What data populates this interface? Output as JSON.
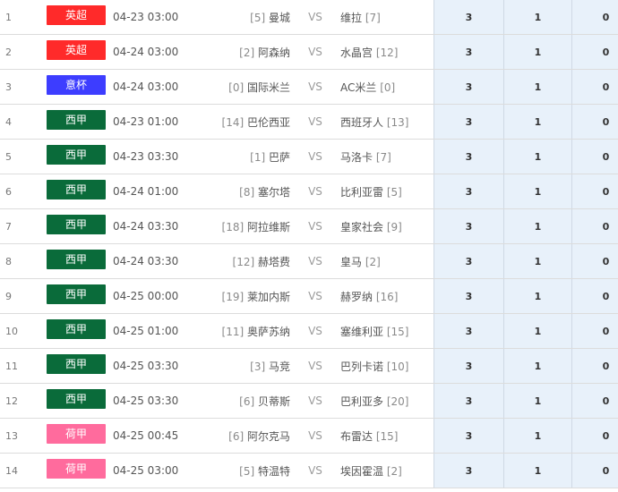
{
  "matches": [
    {
      "idx": "1",
      "league": "英超",
      "league_color": "#ff2a2a",
      "time": "04-23 03:00",
      "home_rank": "[5]",
      "home": "曼城",
      "vs": "VS",
      "away": "维拉",
      "away_rank": "[7]",
      "odds": [
        "3",
        "1",
        "0"
      ]
    },
    {
      "idx": "2",
      "league": "英超",
      "league_color": "#ff2a2a",
      "time": "04-24 03:00",
      "home_rank": "[2]",
      "home": "阿森纳",
      "vs": "VS",
      "away": "水晶宫",
      "away_rank": "[12]",
      "odds": [
        "3",
        "1",
        "0"
      ]
    },
    {
      "idx": "3",
      "league": "意杯",
      "league_color": "#3d3dff",
      "time": "04-24 03:00",
      "home_rank": "[0]",
      "home": "国际米兰",
      "vs": "VS",
      "away": "AC米兰",
      "away_rank": "[0]",
      "odds": [
        "3",
        "1",
        "0"
      ]
    },
    {
      "idx": "4",
      "league": "西甲",
      "league_color": "#0a6b3a",
      "time": "04-23 01:00",
      "home_rank": "[14]",
      "home": "巴伦西亚",
      "vs": "VS",
      "away": "西班牙人",
      "away_rank": "[13]",
      "odds": [
        "3",
        "1",
        "0"
      ]
    },
    {
      "idx": "5",
      "league": "西甲",
      "league_color": "#0a6b3a",
      "time": "04-23 03:30",
      "home_rank": "[1]",
      "home": "巴萨",
      "vs": "VS",
      "away": "马洛卡",
      "away_rank": "[7]",
      "odds": [
        "3",
        "1",
        "0"
      ]
    },
    {
      "idx": "6",
      "league": "西甲",
      "league_color": "#0a6b3a",
      "time": "04-24 01:00",
      "home_rank": "[8]",
      "home": "塞尔塔",
      "vs": "VS",
      "away": "比利亚雷",
      "away_rank": "[5]",
      "odds": [
        "3",
        "1",
        "0"
      ]
    },
    {
      "idx": "7",
      "league": "西甲",
      "league_color": "#0a6b3a",
      "time": "04-24 03:30",
      "home_rank": "[18]",
      "home": "阿拉维斯",
      "vs": "VS",
      "away": "皇家社会",
      "away_rank": "[9]",
      "odds": [
        "3",
        "1",
        "0"
      ]
    },
    {
      "idx": "8",
      "league": "西甲",
      "league_color": "#0a6b3a",
      "time": "04-24 03:30",
      "home_rank": "[12]",
      "home": "赫塔费",
      "vs": "VS",
      "away": "皇马",
      "away_rank": "[2]",
      "odds": [
        "3",
        "1",
        "0"
      ]
    },
    {
      "idx": "9",
      "league": "西甲",
      "league_color": "#0a6b3a",
      "time": "04-25 00:00",
      "home_rank": "[19]",
      "home": "莱加内斯",
      "vs": "VS",
      "away": "赫罗纳",
      "away_rank": "[16]",
      "odds": [
        "3",
        "1",
        "0"
      ]
    },
    {
      "idx": "10",
      "league": "西甲",
      "league_color": "#0a6b3a",
      "time": "04-25 01:00",
      "home_rank": "[11]",
      "home": "奥萨苏纳",
      "vs": "VS",
      "away": "塞维利亚",
      "away_rank": "[15]",
      "odds": [
        "3",
        "1",
        "0"
      ]
    },
    {
      "idx": "11",
      "league": "西甲",
      "league_color": "#0a6b3a",
      "time": "04-25 03:30",
      "home_rank": "[3]",
      "home": "马竞",
      "vs": "VS",
      "away": "巴列卡诺",
      "away_rank": "[10]",
      "odds": [
        "3",
        "1",
        "0"
      ]
    },
    {
      "idx": "12",
      "league": "西甲",
      "league_color": "#0a6b3a",
      "time": "04-25 03:30",
      "home_rank": "[6]",
      "home": "贝蒂斯",
      "vs": "VS",
      "away": "巴利亚多",
      "away_rank": "[20]",
      "odds": [
        "3",
        "1",
        "0"
      ]
    },
    {
      "idx": "13",
      "league": "荷甲",
      "league_color": "#ff6b9d",
      "time": "04-25 00:45",
      "home_rank": "[6]",
      "home": "阿尔克马",
      "vs": "VS",
      "away": "布雷达",
      "away_rank": "[15]",
      "odds": [
        "3",
        "1",
        "0"
      ]
    },
    {
      "idx": "14",
      "league": "荷甲",
      "league_color": "#ff6b9d",
      "time": "04-25 03:00",
      "home_rank": "[5]",
      "home": "特温特",
      "vs": "VS",
      "away": "埃因霍温",
      "away_rank": "[2]",
      "odds": [
        "3",
        "1",
        "0"
      ]
    }
  ]
}
